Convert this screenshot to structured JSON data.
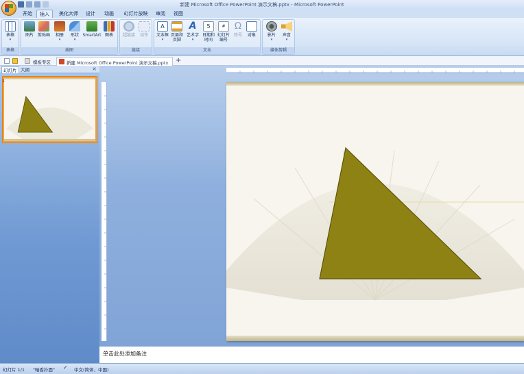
{
  "window": {
    "title": "新建 Microsoft Office PowerPoint 演示文稿.pptx - Microsoft PowerPoint"
  },
  "ribbon": {
    "tabs": [
      "开始",
      "插入",
      "美化大师",
      "设计",
      "动画",
      "幻灯片放映",
      "审阅",
      "视图"
    ],
    "active_tab": "插入",
    "groups": {
      "tables": {
        "label": "表格",
        "buttons": [
          {
            "label": "表格",
            "icon": "table-icon"
          }
        ]
      },
      "illustrations": {
        "label": "插图",
        "buttons": [
          {
            "label": "图片",
            "icon": "picture-icon"
          },
          {
            "label": "剪贴画",
            "icon": "clipart-icon"
          },
          {
            "label": "相册",
            "icon": "photo-album-icon"
          },
          {
            "label": "形状",
            "icon": "shapes-icon"
          },
          {
            "label": "SmartArt",
            "icon": "smartart-icon"
          },
          {
            "label": "图表",
            "icon": "chart-icon"
          }
        ]
      },
      "links": {
        "label": "链接",
        "buttons": [
          {
            "label": "超链接",
            "icon": "hyperlink-icon"
          },
          {
            "label": "动作",
            "icon": "action-icon"
          }
        ]
      },
      "text": {
        "label": "文本",
        "buttons": [
          {
            "label": "文本框",
            "icon": "textbox-icon"
          },
          {
            "label1": "页眉和",
            "label2": "页脚",
            "icon": "header-footer-icon"
          },
          {
            "label": "艺术字",
            "icon": "wordart-icon"
          },
          {
            "label1": "日期和",
            "label2": "时间",
            "icon": "date-time-icon"
          },
          {
            "label1": "幻灯片",
            "label2": "编号",
            "icon": "slide-number-icon"
          },
          {
            "label": "符号",
            "icon": "symbol-icon"
          },
          {
            "label": "对象",
            "icon": "object-icon"
          }
        ]
      },
      "media": {
        "label": "媒体剪辑",
        "buttons": [
          {
            "label": "影片",
            "icon": "movie-icon"
          },
          {
            "label": "声音",
            "icon": "sound-icon"
          }
        ]
      }
    }
  },
  "docbar": {
    "templates_label": "模板专区",
    "doc_tab_label": "新建 Microsoft Office PowerPoint 演示文稿.pptx",
    "new_tab_symbol": "+"
  },
  "left_panel": {
    "tabs": [
      "幻灯片",
      "大纲"
    ],
    "close_symbol": "×",
    "slide_number": "1"
  },
  "notes": {
    "placeholder": "单击此处添加备注"
  },
  "status_bar": {
    "slide_info": "幻灯片 1/1",
    "theme": "\"暗香扑面\"",
    "language": "中文(简体，中国)"
  },
  "colors": {
    "triangle_fill": "#8f8214",
    "triangle_stroke": "#5e560a",
    "ribbon_blue": "#cfdff4",
    "selection_orange": "#f2a23a"
  }
}
